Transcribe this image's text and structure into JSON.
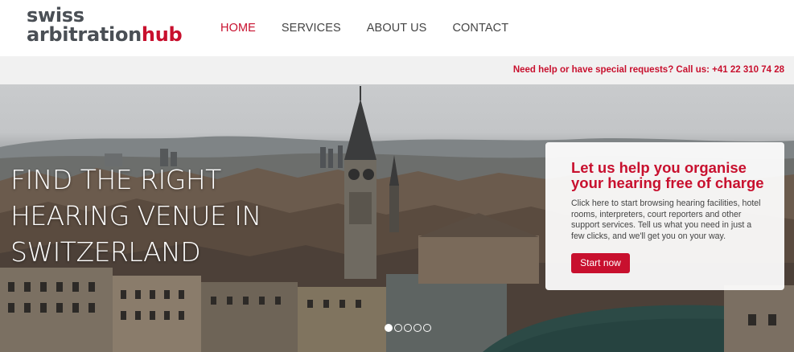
{
  "logo": {
    "line1": "swiss",
    "line2_main": "arbitration",
    "line2_accent": "hub"
  },
  "nav": {
    "items": [
      {
        "label": "HOME",
        "active": true
      },
      {
        "label": "SERVICES",
        "active": false
      },
      {
        "label": "ABOUT US",
        "active": false
      },
      {
        "label": "CONTACT",
        "active": false
      }
    ]
  },
  "help_bar": {
    "text": "Need help or have special requests? Call us: +41 22 310 74 28"
  },
  "hero": {
    "title": "FIND THE RIGHT HEARING VENUE IN SWITZERLAND",
    "background_image": "city-skyline-photo"
  },
  "promo": {
    "heading": "Let us help you organise your hearing free of charge",
    "body": "Click here to start browsing hearing facilities, hotel rooms, interpreters, court reporters and other support services. Tell us what you need in just a few clicks, and we'll get you on your way.",
    "button_label": "Start now"
  },
  "carousel": {
    "slides": 5,
    "active_index": 0
  },
  "colors": {
    "accent": "#c8102e",
    "logo_gray": "#4a4f55",
    "help_bar_bg": "#f1f1f1"
  }
}
